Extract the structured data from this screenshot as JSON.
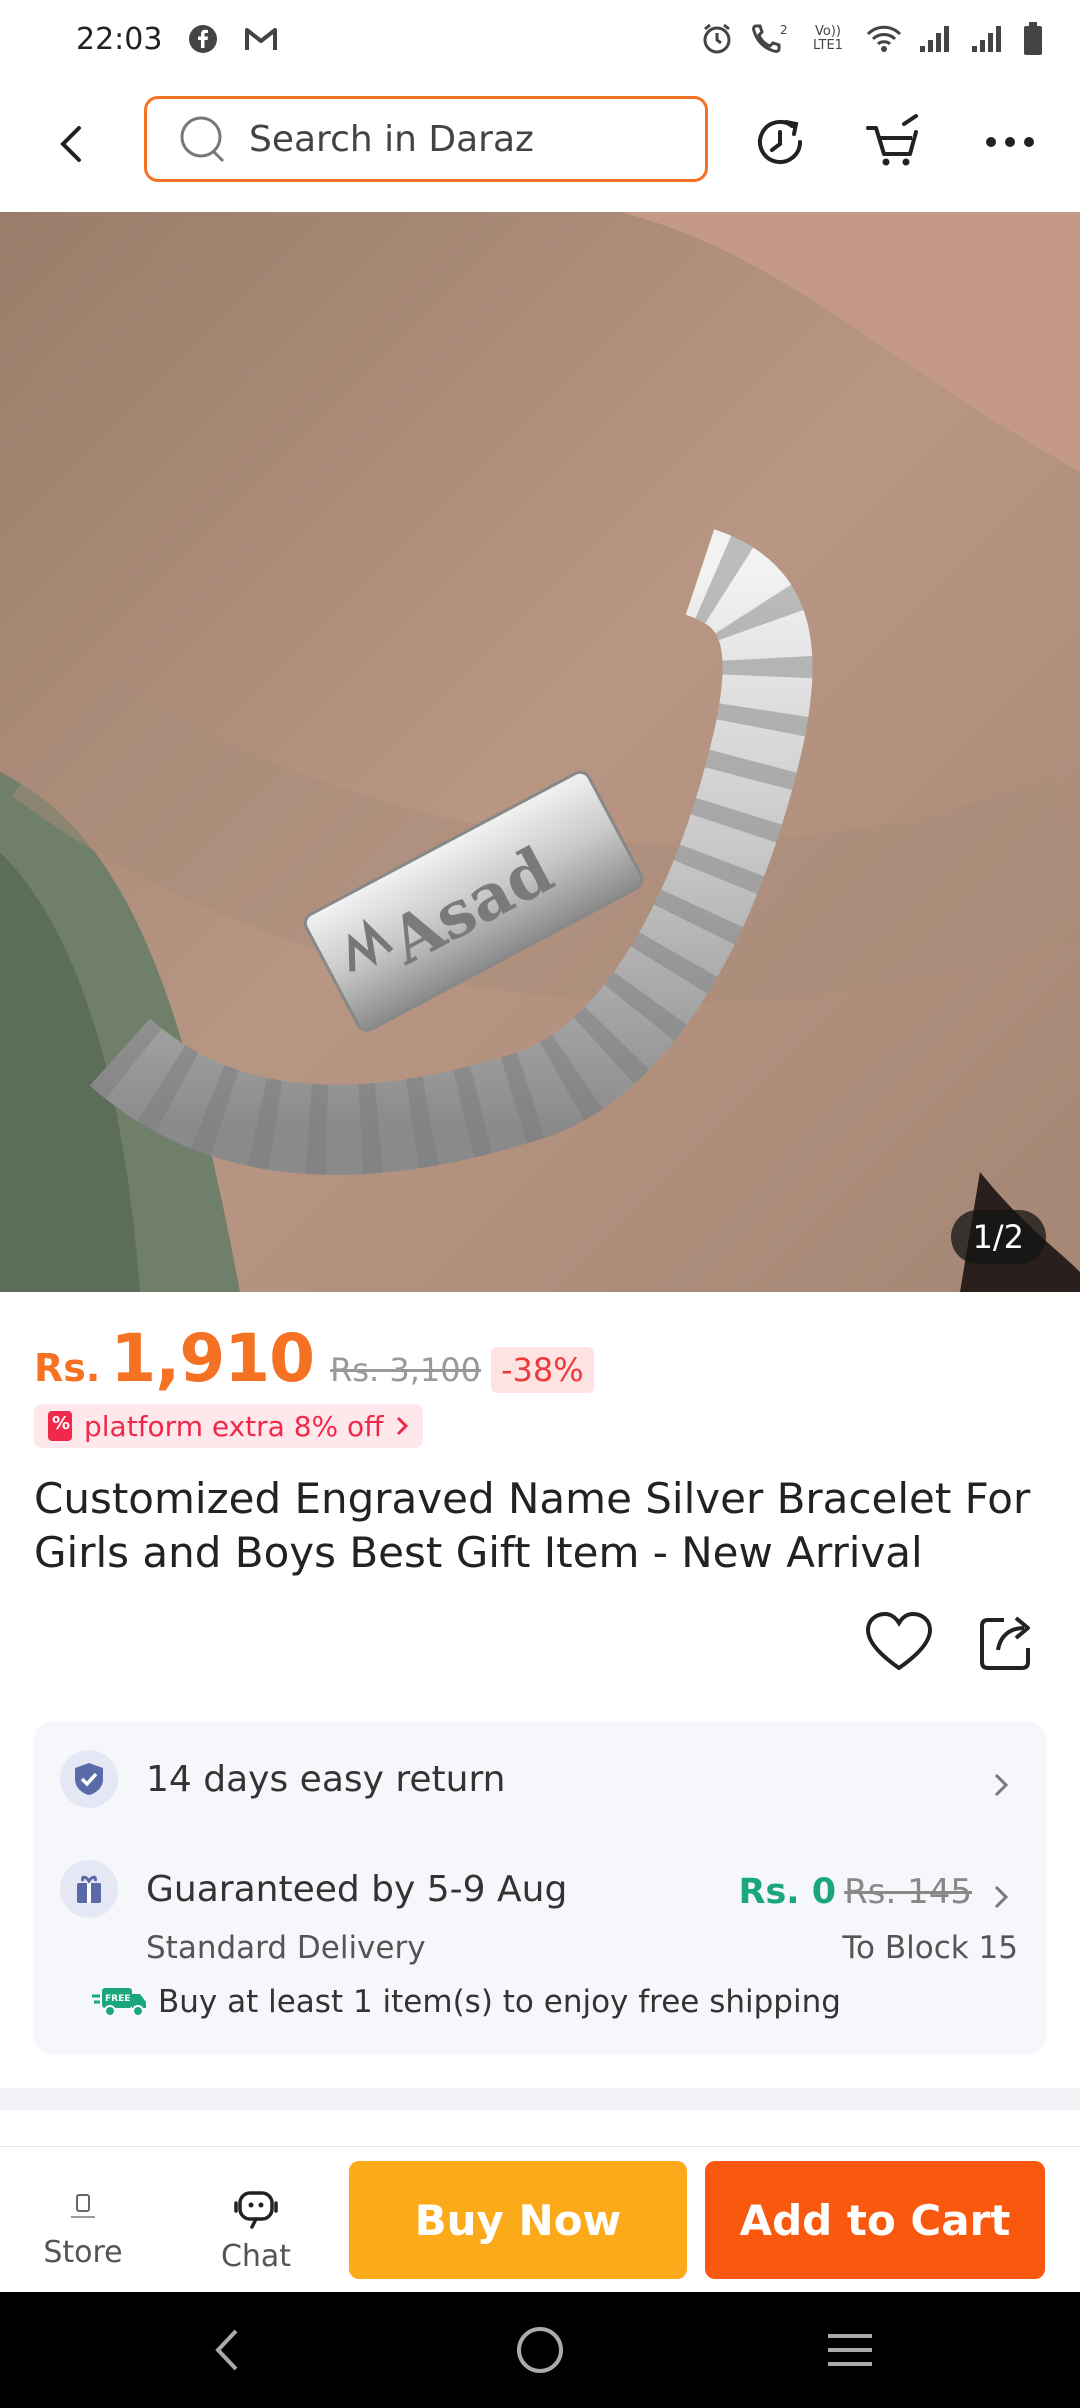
{
  "status_bar": {
    "time": "22:03",
    "volte": "Vo)) LTE1",
    "network": "2"
  },
  "search": {
    "placeholder": "Search in Daraz"
  },
  "image": {
    "counter": "1/2",
    "engraving": "Asad"
  },
  "price": {
    "currency": "Rs.",
    "current": "1,910",
    "original": "Rs. 3,100",
    "discount": "-38%"
  },
  "promo": {
    "label": "platform extra 8% off"
  },
  "product": {
    "title": "Customized Engraved Name Silver Bracelet For Girls and Boys Best Gift Item - New Arrival"
  },
  "return": {
    "label": "14 days easy return"
  },
  "delivery": {
    "guarantee": "Guaranteed by 5-9 Aug",
    "type": "Standard Delivery",
    "fee": "Rs. 0",
    "fee_original": "Rs. 145",
    "destination": "To Block 15",
    "free_ship_badge": "FREE",
    "free_ship_text": "Buy at least 1 item(s) to enjoy free shipping"
  },
  "actions": {
    "store": "Store",
    "chat": "Chat",
    "buy_now": "Buy Now",
    "add_to_cart": "Add to Cart"
  },
  "colors": {
    "brand_orange": "#f57224",
    "buy_now": "#fca91a",
    "add_to_cart": "#f9580f",
    "free_green": "#1aa77c",
    "promo_red": "#f0294a"
  }
}
